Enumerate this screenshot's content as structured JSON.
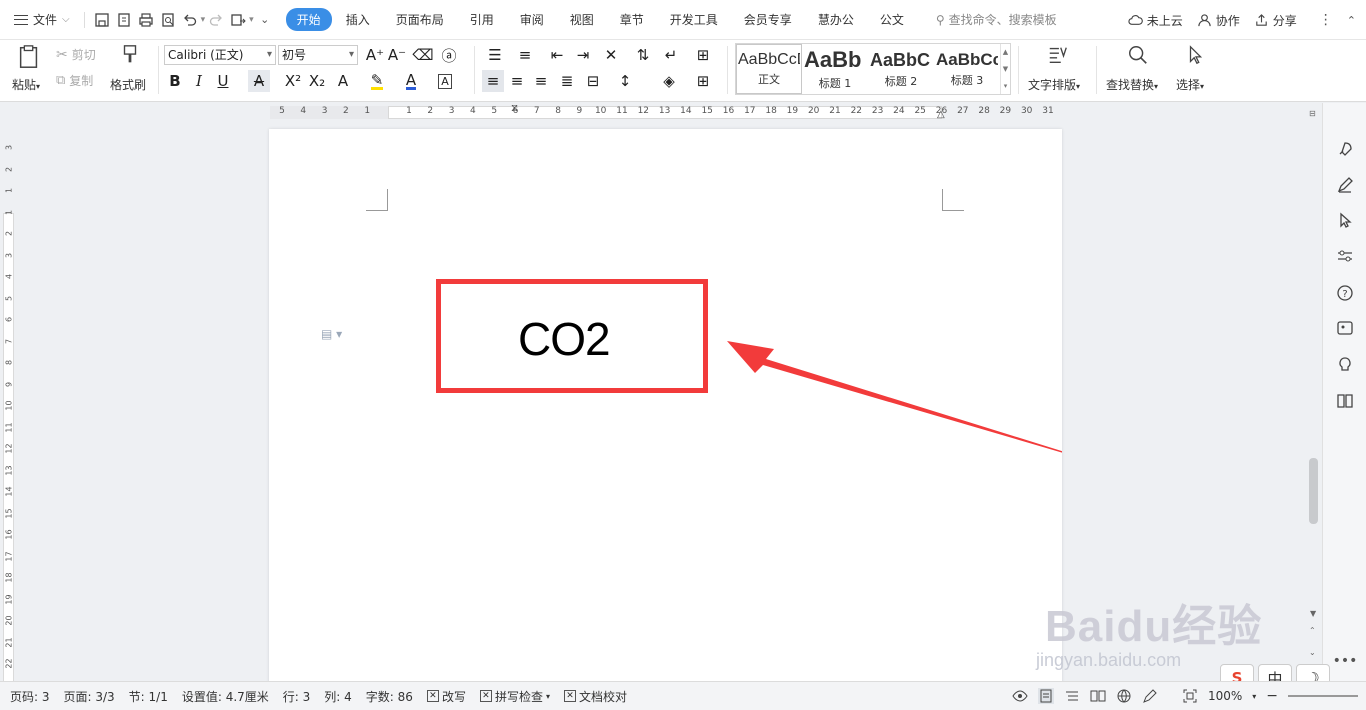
{
  "menubar": {
    "file_label": "文件",
    "tabs": [
      {
        "label": "开始",
        "active": true
      },
      {
        "label": "插入"
      },
      {
        "label": "页面布局"
      },
      {
        "label": "引用"
      },
      {
        "label": "审阅"
      },
      {
        "label": "视图"
      },
      {
        "label": "章节"
      },
      {
        "label": "开发工具"
      },
      {
        "label": "会员专享"
      },
      {
        "label": "慧办公"
      },
      {
        "label": "公文"
      }
    ],
    "search_placeholder": "查找命令、搜索模板",
    "cloud_label": "未上云",
    "collab_label": "协作",
    "share_label": "分享"
  },
  "ribbon": {
    "paste_label": "粘贴",
    "cut_label": "剪切",
    "copy_label": "复制",
    "format_painter_label": "格式刷",
    "font_name": "Calibri (正文)",
    "font_size": "初号",
    "styles": [
      {
        "sample": "AaBbCcDd",
        "name": "正文"
      },
      {
        "sample": "AaBb",
        "name": "标题 1"
      },
      {
        "sample": "AaBbC",
        "name": "标题 2"
      },
      {
        "sample": "AaBbCc",
        "name": "标题 3"
      }
    ],
    "text_layout_label": "文字排版",
    "find_replace_label": "查找替换",
    "select_label": "选择"
  },
  "ruler": {
    "left_numbers": [
      "5",
      "4",
      "3",
      "2",
      "1"
    ],
    "right_numbers": [
      "1",
      "2",
      "3",
      "4",
      "5",
      "6",
      "7",
      "8",
      "9",
      "10",
      "11",
      "12",
      "13",
      "14",
      "15",
      "16",
      "17",
      "18",
      "19",
      "20",
      "21",
      "22",
      "23",
      "24",
      "25",
      "26",
      "27",
      "28",
      "29",
      "30",
      "31"
    ],
    "vertical_numbers": [
      "3",
      "2",
      "1",
      "1",
      "2",
      "3",
      "4",
      "5",
      "6",
      "7",
      "8",
      "9",
      "10",
      "11",
      "12",
      "13",
      "14",
      "15",
      "16",
      "17",
      "18",
      "19",
      "20",
      "21",
      "22"
    ]
  },
  "document": {
    "text": "CO2",
    "highlight_color": "#f23b3b"
  },
  "statusbar": {
    "page_code": "页码: 3",
    "pages": "页面: 3/3",
    "section": "节: 1/1",
    "setting": "设置值: 4.7厘米",
    "row": "行: 3",
    "col": "列: 4",
    "word_count": "字数: 86",
    "overwrite": "改写",
    "spell_check": "拼写检查",
    "doc_proof": "文档校对",
    "zoom": "100%"
  },
  "watermark": {
    "brand": "Baidu经验",
    "url": "jingyan.baidu.com"
  },
  "ime": {
    "logo": "S",
    "mode": "中",
    "moon": "☽"
  },
  "colors": {
    "accent_tab": "#3a8ee6",
    "annotation_red": "#f23b3b"
  }
}
